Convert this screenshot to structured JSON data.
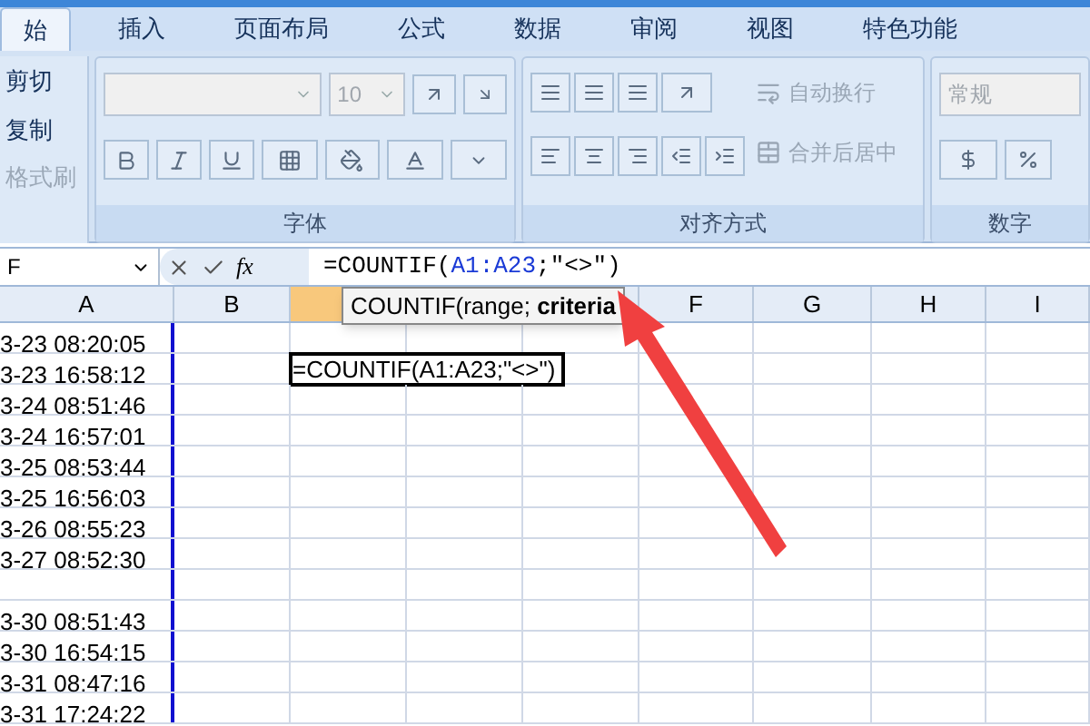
{
  "tabs": [
    {
      "label": "始",
      "selected": true
    },
    {
      "label": "插入",
      "selected": false
    },
    {
      "label": "页面布局",
      "selected": false
    },
    {
      "label": "公式",
      "selected": false
    },
    {
      "label": "数据",
      "selected": false
    },
    {
      "label": "审阅",
      "selected": false
    },
    {
      "label": "视图",
      "selected": false
    },
    {
      "label": "特色功能",
      "selected": false
    }
  ],
  "clipboard": {
    "items": [
      {
        "label": "剪切",
        "disabled": false
      },
      {
        "label": "复制",
        "disabled": false
      },
      {
        "label": "格式刷",
        "disabled": true
      }
    ]
  },
  "font_group": {
    "label": "字体",
    "font_size": "10"
  },
  "alignment_group": {
    "label": "对齐方式",
    "wrap_text": "自动换行",
    "merge_center": "合并后居中"
  },
  "number_group": {
    "label": "数字",
    "format": "常规"
  },
  "formula_bar": {
    "name_box": "F",
    "fx_label": "fx",
    "formula": {
      "start": "=COUNTIF(",
      "reference": "A1:A23",
      "end": ";\"<>\")"
    }
  },
  "tooltip": {
    "text": "COUNTIF(range; **criteria**"
  },
  "columns": [
    {
      "label": "A",
      "selected": false
    },
    {
      "label": "B",
      "selected": false
    },
    {
      "selected": true
    },
    {
      "label": "F",
      "selected": false
    },
    {
      "label": "G",
      "selected": false
    },
    {
      "label": "H",
      "selected": false
    },
    {
      "label": "I",
      "selected": false
    }
  ],
  "rows": [
    {
      "a": "3-23 08:20:05"
    },
    {
      "a": "3-23 16:58:12",
      "edit": "=COUNTIF(A1:A23;\"<>\")"
    },
    {
      "a": "3-24 08:51:46"
    },
    {
      "a": "3-24 16:57:01"
    },
    {
      "a": "3-25 08:53:44"
    },
    {
      "a": "3-25 16:56:03"
    },
    {
      "a": "3-26 08:55:23"
    },
    {
      "a": "3-27 08:52:30"
    },
    {
      "a": ""
    },
    {
      "a": "3-30 08:51:43"
    },
    {
      "a": "3-30 16:54:15"
    },
    {
      "a": "3-31 08:47:16"
    },
    {
      "a": "3-31 17:24:22"
    }
  ]
}
